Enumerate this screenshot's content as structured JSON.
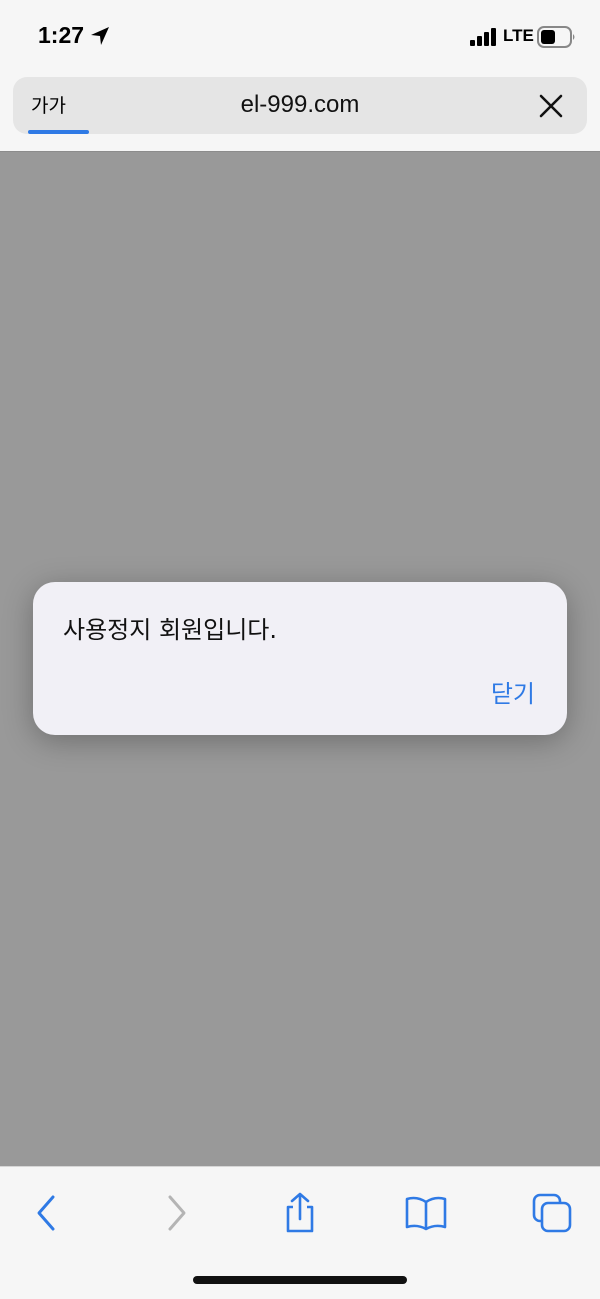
{
  "status_bar": {
    "time": "1:27",
    "network": "LTE",
    "icons": [
      "location-arrow-icon",
      "signal-icon",
      "battery-icon"
    ]
  },
  "address_bar": {
    "text_size_label": "가가",
    "url": "el-999.com",
    "load_progress": 0.11,
    "accent_color": "#2f7ae5"
  },
  "alert": {
    "message": "사용정지 회원입니다.",
    "close_label": "닫기"
  },
  "toolbar": {
    "icons": [
      "back-icon",
      "forward-icon",
      "share-icon",
      "bookmarks-icon",
      "tabs-icon"
    ]
  }
}
